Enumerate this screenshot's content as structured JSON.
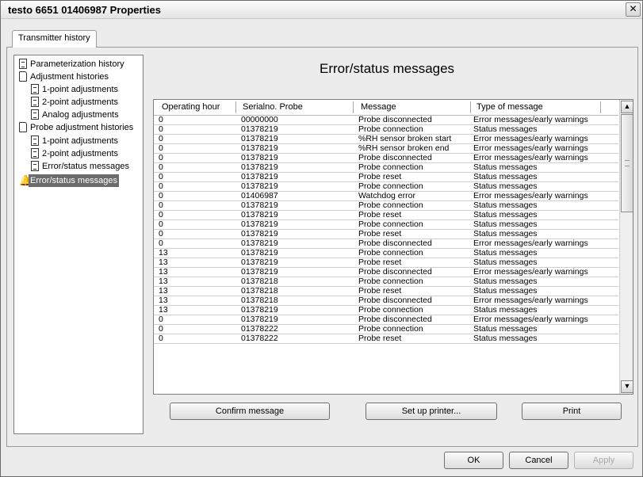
{
  "window": {
    "title": "testo 6651  01406987 Properties"
  },
  "tab": {
    "label": "Transmitter history"
  },
  "tree": [
    {
      "label": "Parameterization history",
      "icon": "document-icon"
    },
    {
      "label": "Adjustment histories",
      "icon": "folder-icon"
    },
    {
      "label": "1-point adjustments",
      "icon": "document-icon"
    },
    {
      "label": "2-point adjustments",
      "icon": "document-icon"
    },
    {
      "label": "Analog adjustments",
      "icon": "document-icon"
    },
    {
      "label": "Probe adjustment histories",
      "icon": "folder-icon"
    },
    {
      "label": "1-point adjustments",
      "icon": "document-icon"
    },
    {
      "label": "2-point adjustments",
      "icon": "document-icon"
    },
    {
      "label": "Error/status messages",
      "icon": "document-icon"
    },
    {
      "label": "Error/status messages",
      "icon": "bell-icon",
      "selected": true
    }
  ],
  "panel": {
    "heading": "Error/status messages"
  },
  "table": {
    "columns": [
      "Operating hour",
      "Serialno. Probe",
      "Message",
      "Type of message"
    ],
    "rows": [
      [
        "0",
        "00000000",
        "Probe disconnected",
        "Error messages/early warnings"
      ],
      [
        "0",
        "01378219",
        "Probe connection",
        "Status messages"
      ],
      [
        "0",
        "01378219",
        "%RH sensor broken start",
        "Error messages/early warnings"
      ],
      [
        "0",
        "01378219",
        "%RH sensor broken end",
        "Error messages/early warnings"
      ],
      [
        "0",
        "01378219",
        "Probe disconnected",
        "Error messages/early warnings"
      ],
      [
        "0",
        "01378219",
        "Probe connection",
        "Status messages"
      ],
      [
        "0",
        "01378219",
        "Probe reset",
        "Status messages"
      ],
      [
        "0",
        "01378219",
        "Probe connection",
        "Status messages"
      ],
      [
        "0",
        "01406987",
        "Watchdog error",
        "Error messages/early warnings"
      ],
      [
        "0",
        "01378219",
        "Probe connection",
        "Status messages"
      ],
      [
        "0",
        "01378219",
        "Probe reset",
        "Status messages"
      ],
      [
        "0",
        "01378219",
        "Probe connection",
        "Status messages"
      ],
      [
        "0",
        "01378219",
        "Probe reset",
        "Status messages"
      ],
      [
        "0",
        "01378219",
        "Probe disconnected",
        "Error messages/early warnings"
      ],
      [
        "13",
        "01378219",
        "Probe connection",
        "Status messages"
      ],
      [
        "13",
        "01378219",
        "Probe reset",
        "Status messages"
      ],
      [
        "13",
        "01378219",
        "Probe disconnected",
        "Error messages/early warnings"
      ],
      [
        "13",
        "01378218",
        "Probe connection",
        "Status messages"
      ],
      [
        "13",
        "01378218",
        "Probe reset",
        "Status messages"
      ],
      [
        "13",
        "01378218",
        "Probe disconnected",
        "Error messages/early warnings"
      ],
      [
        "13",
        "01378219",
        "Probe connection",
        "Status messages"
      ],
      [
        "0",
        "01378219",
        "Probe disconnected",
        "Error messages/early warnings"
      ],
      [
        "0",
        "01378222",
        "Probe connection",
        "Status messages"
      ],
      [
        "0",
        "01378222",
        "Probe reset",
        "Status messages"
      ]
    ]
  },
  "actions": {
    "confirm": "Confirm message",
    "setup_printer": "Set up printer...",
    "print": "Print"
  },
  "footer": {
    "ok": "OK",
    "cancel": "Cancel",
    "apply": "Apply"
  },
  "icons": {
    "close": "close-icon",
    "scroll_up": "scroll-up-icon",
    "scroll_down": "scroll-down-icon"
  }
}
